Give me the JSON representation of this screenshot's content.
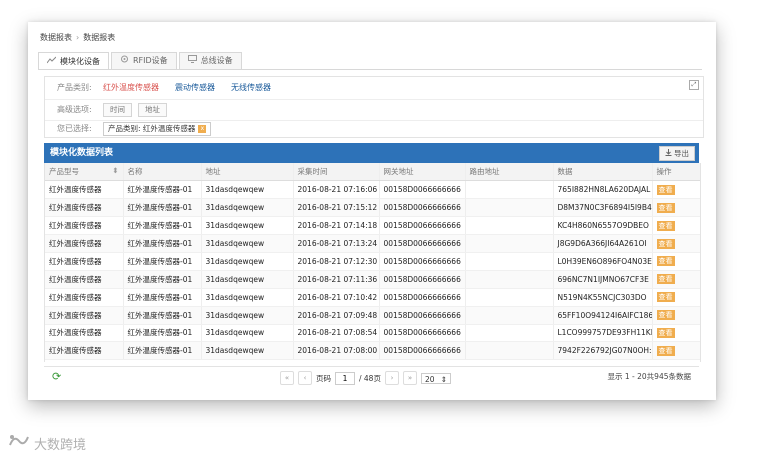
{
  "breadcrumb": [
    "数据报表",
    "数据报表"
  ],
  "tabs": [
    {
      "label": "模块化设备",
      "icon": "chart-icon",
      "active": true
    },
    {
      "label": "RFID设备",
      "icon": "rfid-icon",
      "active": false
    },
    {
      "label": "总线设备",
      "icon": "monitor-icon",
      "active": false
    }
  ],
  "filters": {
    "category_label": "产品类别:",
    "categories": [
      "红外温度传感器",
      "震动传感器",
      "无线传感器"
    ],
    "active_category_index": 0,
    "advanced_label": "高级选项:",
    "advanced_options": [
      "时间",
      "地址"
    ],
    "selected_label": "您已选择:",
    "selected_chip": "产品类别: 红外温度传感器",
    "selected_chip_remove": "x"
  },
  "list": {
    "title": "模块化数据列表",
    "export_label": "导出",
    "columns": [
      "产品型号",
      "名称",
      "地址",
      "采集时间",
      "网关地址",
      "路由地址",
      "数据",
      "操作"
    ],
    "rows": [
      [
        "红外温度传感器",
        "红外温度传感器-01",
        "31dasdqewqew",
        "2016-08-21 07:16:06",
        "00158D0066666666",
        "",
        "765I882HN8LA620DAJAL",
        "查看"
      ],
      [
        "红外温度传感器",
        "红外温度传感器-01",
        "31dasdqewqew",
        "2016-08-21 07:15:12",
        "00158D0066666666",
        "",
        "D8M37N0C3F6894I5I9B4",
        "查看"
      ],
      [
        "红外温度传感器",
        "红外温度传感器-01",
        "31dasdqewqew",
        "2016-08-21 07:14:18",
        "00158D0066666666",
        "",
        "KC4H860N6557O9DBEO",
        "查看"
      ],
      [
        "红外温度传感器",
        "红外温度传感器-01",
        "31dasdqewqew",
        "2016-08-21 07:13:24",
        "00158D0066666666",
        "",
        "J8G9D6A366JI64A261OI",
        "查看"
      ],
      [
        "红外温度传感器",
        "红外温度传感器-01",
        "31dasdqewqew",
        "2016-08-21 07:12:30",
        "00158D0066666666",
        "",
        "L0H39EN6O896FO4N03E",
        "查看"
      ],
      [
        "红外温度传感器",
        "红外温度传感器-01",
        "31dasdqewqew",
        "2016-08-21 07:11:36",
        "00158D0066666666",
        "",
        "696NC7N1IJMNO67CF3E",
        "查看"
      ],
      [
        "红外温度传感器",
        "红外温度传感器-01",
        "31dasdqewqew",
        "2016-08-21 07:10:42",
        "00158D0066666666",
        "",
        "N519N4K55NCJC303DO",
        "查看"
      ],
      [
        "红外温度传感器",
        "红外温度传感器-01",
        "31dasdqewqew",
        "2016-08-21 07:09:48",
        "00158D0066666666",
        "",
        "65FF10O94124I6AIFC186",
        "查看"
      ],
      [
        "红外温度传感器",
        "红外温度传感器-01",
        "31dasdqewqew",
        "2016-08-21 07:08:54",
        "00158D0066666666",
        "",
        "L1CO999757DE93FH11KI",
        "查看"
      ],
      [
        "红外温度传感器",
        "红外温度传感器-01",
        "31dasdqewqew",
        "2016-08-21 07:08:00",
        "00158D0066666666",
        "",
        "7942F226792JG07N0OH:",
        "查看"
      ]
    ]
  },
  "pager": {
    "first": "«",
    "prev": "‹",
    "next": "›",
    "last": "»",
    "page_label": "页码",
    "page_value": "1",
    "total_pages": "/ 48页",
    "page_size": "20",
    "info": "显示 1 - 20共945条数据"
  },
  "watermark": "大数跨境",
  "colors": {
    "header_blue": "#2d72b8",
    "active_red": "#d9534f",
    "link_blue": "#1a5a9a",
    "view_orange": "#f0ad4e",
    "refresh_green": "#3a9a3a"
  }
}
